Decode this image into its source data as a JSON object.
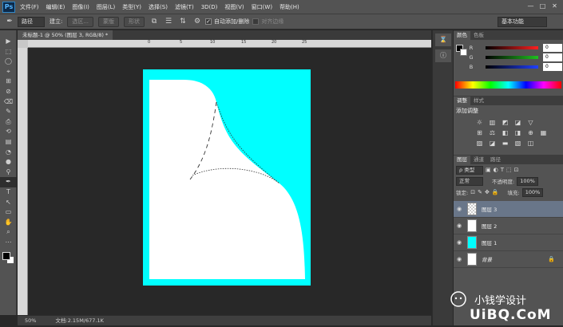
{
  "app": {
    "logo": "Ps"
  },
  "menu": [
    "文件(F)",
    "编辑(E)",
    "图像(I)",
    "图层(L)",
    "类型(Y)",
    "选择(S)",
    "滤镜(T)",
    "3D(D)",
    "视图(V)",
    "窗口(W)",
    "帮助(H)"
  ],
  "window_controls": [
    "—",
    "□",
    "✕"
  ],
  "options": {
    "path_mode": "路径",
    "build_label": "建立:",
    "selection_btn": "选区...",
    "mask_btn": "蒙版",
    "shape_btn": "形状",
    "auto_add_delete": "自动添加/删除",
    "align_edges": "对齐边缘",
    "workspace": "基本功能"
  },
  "document": {
    "tab": "未标题-1 @ 50% (图层 3, RGB/8) *",
    "ruler_ticks": [
      "0",
      "5",
      "10",
      "15",
      "20",
      "25"
    ],
    "bg_color": "#ffffff",
    "cyan": "#00ffff"
  },
  "status": {
    "zoom": "50%",
    "doc": "文档:2.15M/677.1K"
  },
  "color_panel": {
    "tabs": [
      "颜色",
      "色板"
    ],
    "rows": [
      {
        "label": "R",
        "value": "0",
        "color": "#ff2020"
      },
      {
        "label": "G",
        "value": "0",
        "color": "#20c020"
      },
      {
        "label": "B",
        "value": "0",
        "color": "#2040ff"
      }
    ]
  },
  "adjust_panel": {
    "tabs": [
      "调整",
      "样式"
    ],
    "title": "添加调整",
    "icons": [
      "☼",
      "▥",
      "◩",
      "◪",
      "▽",
      "",
      "⊞",
      "⚖",
      "◧",
      "◨",
      "⊕",
      "▦",
      "▨",
      "◪",
      "▬",
      "▧",
      "◫",
      ""
    ]
  },
  "layers_panel": {
    "tabs": [
      "图层",
      "通道",
      "路径"
    ],
    "kind_label": "ρ 类型",
    "filter_icons": [
      "▣",
      "◐",
      "T",
      "⬚",
      "⊡"
    ],
    "blend_mode": "正常",
    "opacity_label": "不透明度:",
    "opacity": "100%",
    "lock_label": "锁定:",
    "lock_icons": [
      "⊡",
      "✎",
      "✥",
      "🔒"
    ],
    "fill_label": "填充:",
    "fill": "100%",
    "layers": [
      {
        "name": "图层 3",
        "selected": true,
        "thumb": "#eeeeee"
      },
      {
        "name": "图层 2",
        "selected": false,
        "thumb": "#ffffff"
      },
      {
        "name": "图层 1",
        "selected": false,
        "thumb": "#00ffff"
      },
      {
        "name": "背景",
        "selected": false,
        "thumb": "#ffffff",
        "locked": true
      }
    ]
  },
  "watermark": {
    "text": "小钱学设计",
    "site": "UiBQ.CoM"
  },
  "tools": [
    "▶",
    "⬚",
    "◯",
    "⌖",
    "⊞",
    "⊘",
    "⌫",
    "✎",
    "⎙",
    "⟲",
    "▤",
    "◔",
    "●",
    "⚲",
    "✒",
    "T",
    "↖",
    "▭",
    "✋",
    "⌕",
    "⋯"
  ]
}
